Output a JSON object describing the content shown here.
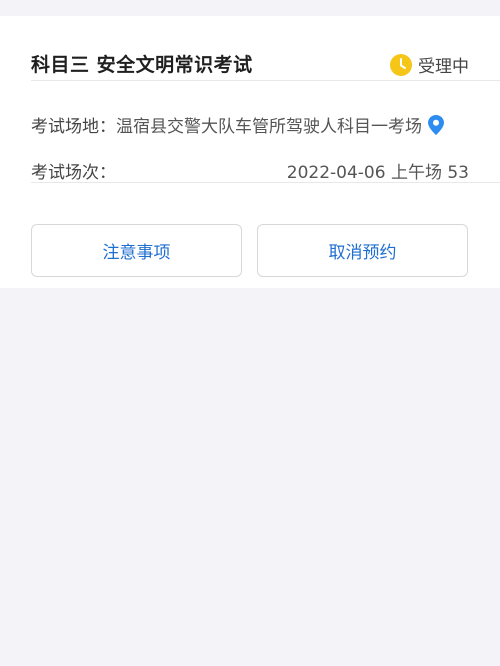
{
  "exam": {
    "title": "科目三 安全文明常识考试",
    "status": "受理中",
    "status_icon": "clock-icon",
    "status_color": "#f5c518",
    "venue_label": "考试场地：",
    "venue_value": "温宿县交警大队车管所驾驶人科目一考场",
    "venue_icon": "location-pin-icon",
    "venue_icon_color": "#2d8cf0",
    "session_label": "考试场次：",
    "session_value": "2022-04-06 上午场 53"
  },
  "actions": {
    "notice_label": "注意事项",
    "cancel_label": "取消预约",
    "accent_color": "#1f6fd1"
  }
}
